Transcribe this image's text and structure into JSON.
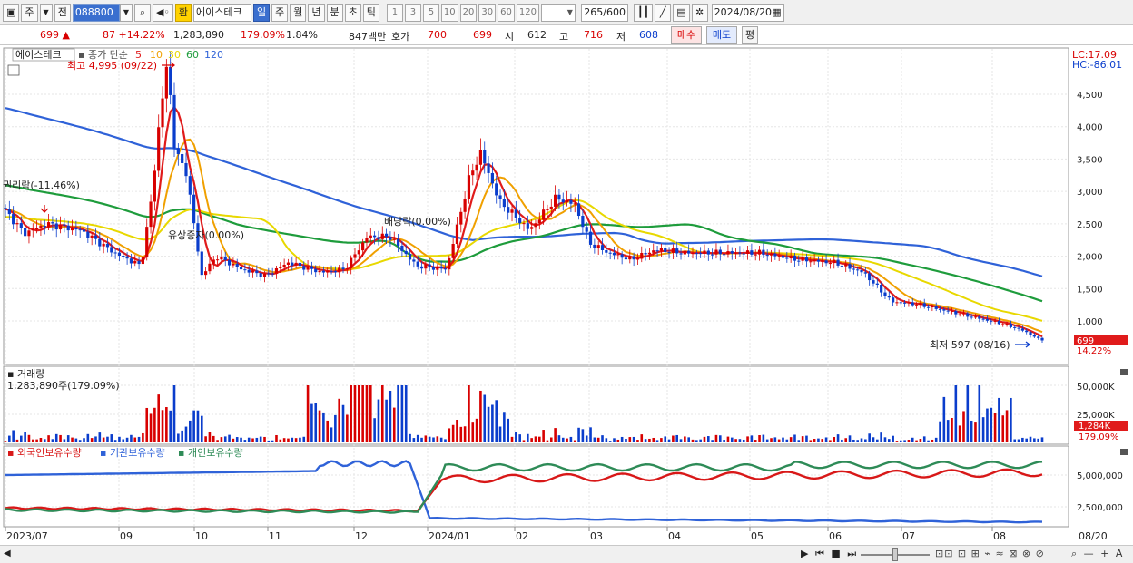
{
  "toolbar": {
    "tab_stock": "주",
    "tab_prev": "전",
    "code": "088800",
    "exchange_label": "환",
    "stock_name": "에이스테크",
    "periods": [
      "일",
      "주",
      "월",
      "년",
      "분",
      "초",
      "틱"
    ],
    "selected_period": "일",
    "intervals": [
      "1",
      "3",
      "5",
      "10",
      "20",
      "30",
      "60",
      "120"
    ],
    "count": "265",
    "count_total": "/600",
    "date": "2024/08/20"
  },
  "quote": {
    "price": "699",
    "change": "87",
    "change_pct": "+14.22%",
    "volume": "1,283,890",
    "volume_pct": "179.09%",
    "turnover": "1.84%",
    "amount": "847백만",
    "ask_label": "호가",
    "ask": "700",
    "bid": "699",
    "open_label": "시",
    "open": "612",
    "high_label": "고",
    "high": "716",
    "low_label": "저",
    "low": "608",
    "buy_button": "매수",
    "sell_button": "매도",
    "eval_button": "평"
  },
  "price_panel": {
    "title": "에이스테크",
    "legend_prefix": "종가 단순",
    "ma_labels": [
      "5",
      "10",
      "30",
      "60",
      "120"
    ],
    "ma_colors": [
      "#e01b1b",
      "#f0a000",
      "#e8d800",
      "#1e9c3c",
      "#2f62d8"
    ],
    "lc": "LC:17.09",
    "hc": "HC:-86.01",
    "high_note": "최고 4,995 (09/22)",
    "low_note": "최저 597 (08/16)",
    "event_rights": "권리락(-11.46%)",
    "event_rights_offering": "유상증자(0.00%)",
    "event_dividend": "배당락(0.00%)",
    "current_price_tag": "699",
    "current_pct_tag": "14.22%",
    "y_labels": [
      "4,500",
      "4,000",
      "3,500",
      "3,000",
      "2,500",
      "2,000",
      "1,500",
      "1,000"
    ]
  },
  "volume_panel": {
    "title": "거래량",
    "value": "1,283,890주(179.09%)",
    "y_labels": [
      "50,000K",
      "25,000K"
    ],
    "tag": "1,284K",
    "tag_pct": "179.09%"
  },
  "holdings_panel": {
    "series": [
      "외국인보유수량",
      "기관보유수량",
      "개인보유수량"
    ],
    "y_labels": [
      "5,000,000",
      "2,500,000"
    ]
  },
  "x_axis": {
    "labels": [
      "2023/07",
      "09",
      "10",
      "11",
      "12",
      "2024/01",
      "02",
      "03",
      "04",
      "05",
      "06",
      "07",
      "08"
    ],
    "end_label": "08/20"
  },
  "colors": {
    "up": "#d80000",
    "down": "#0a3dcc",
    "foreign": "#2f62d8",
    "institution": "#d81818",
    "individual": "#2e8b57"
  }
}
